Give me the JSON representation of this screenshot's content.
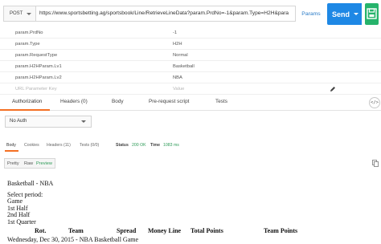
{
  "request": {
    "method": "POST",
    "url": "https://www.sportsbetting.ag/sportsbook/Line/RetrieveLineData?param.PrdNo=-1&param.Type=H2H&para",
    "params_label": "Params",
    "send_label": "Send"
  },
  "params": [
    {
      "key": "param.PrdNo",
      "value": "-1"
    },
    {
      "key": "param.Type",
      "value": "H2H"
    },
    {
      "key": "param.RequestType",
      "value": "Normal"
    },
    {
      "key": "param.H2HParam.Lv1",
      "value": "Basketball"
    },
    {
      "key": "param.H2HParam.Lv2",
      "value": "NBA"
    }
  ],
  "param_placeholder": {
    "key": "URL Parameter Key",
    "value": "Value"
  },
  "request_tabs": [
    "Authorization",
    "Headers (0)",
    "Body",
    "Pre-request script",
    "Tests"
  ],
  "code_label": "</>",
  "auth_type": "No Auth",
  "response_tabs": [
    "Body",
    "Cookies",
    "Headers (11)",
    "Tests (0/0)"
  ],
  "status": {
    "status_label": "Status",
    "status_value": "200 OK",
    "time_label": "Time",
    "time_value": "1083 ms"
  },
  "view_modes": [
    "Pretty",
    "Raw",
    "Preview"
  ],
  "preview": {
    "heading": "Basketball - NBA",
    "select_label": "Select period:",
    "periods": [
      "Game",
      "1st Half",
      "2nd Half",
      "1st Quarter"
    ],
    "columns": [
      "Rot.",
      "Team",
      "Spread",
      "Money Line",
      "Total Points",
      "Team Points"
    ],
    "game_date": "Wednesday, Dec 30, 2015 - NBA Basketball Game"
  },
  "colors": {
    "accent": "#f47023",
    "send": "#1e88e5",
    "save": "#26b36b",
    "ok": "#2e9b58"
  }
}
